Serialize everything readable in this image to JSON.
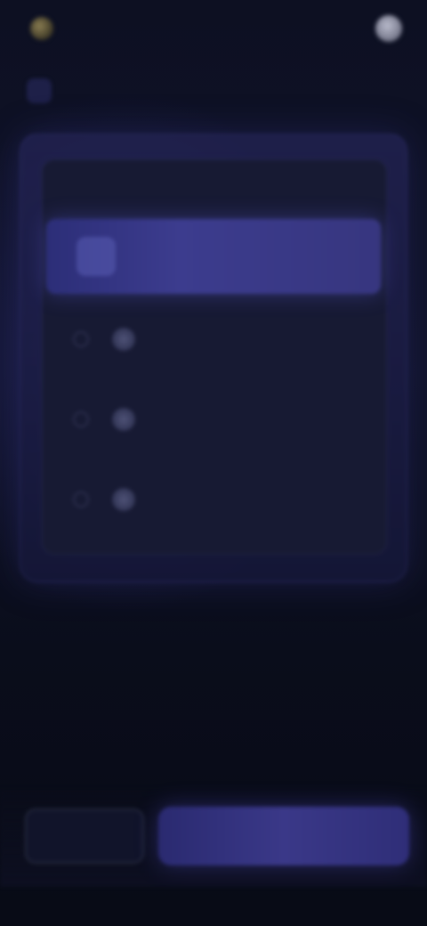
{
  "header": {
    "brand_name": "",
    "link_label": ""
  },
  "crumb": {
    "pill_label": "",
    "sub_label": ""
  },
  "card": {
    "title": "",
    "hero_option_label": "",
    "options": [
      {
        "label": "",
        "sub": ""
      },
      {
        "label": "",
        "sub": ""
      },
      {
        "label": "",
        "sub": ""
      }
    ]
  },
  "footer": {
    "back_label": "",
    "next_label": ""
  },
  "colors": {
    "background": "#090c19",
    "accent": "#3c3c8e",
    "panel": "#24245a"
  },
  "icons": {
    "brand": "brand-logo-icon",
    "avatar": "avatar-icon",
    "hero": "option-hero-icon",
    "option": "option-icon"
  }
}
